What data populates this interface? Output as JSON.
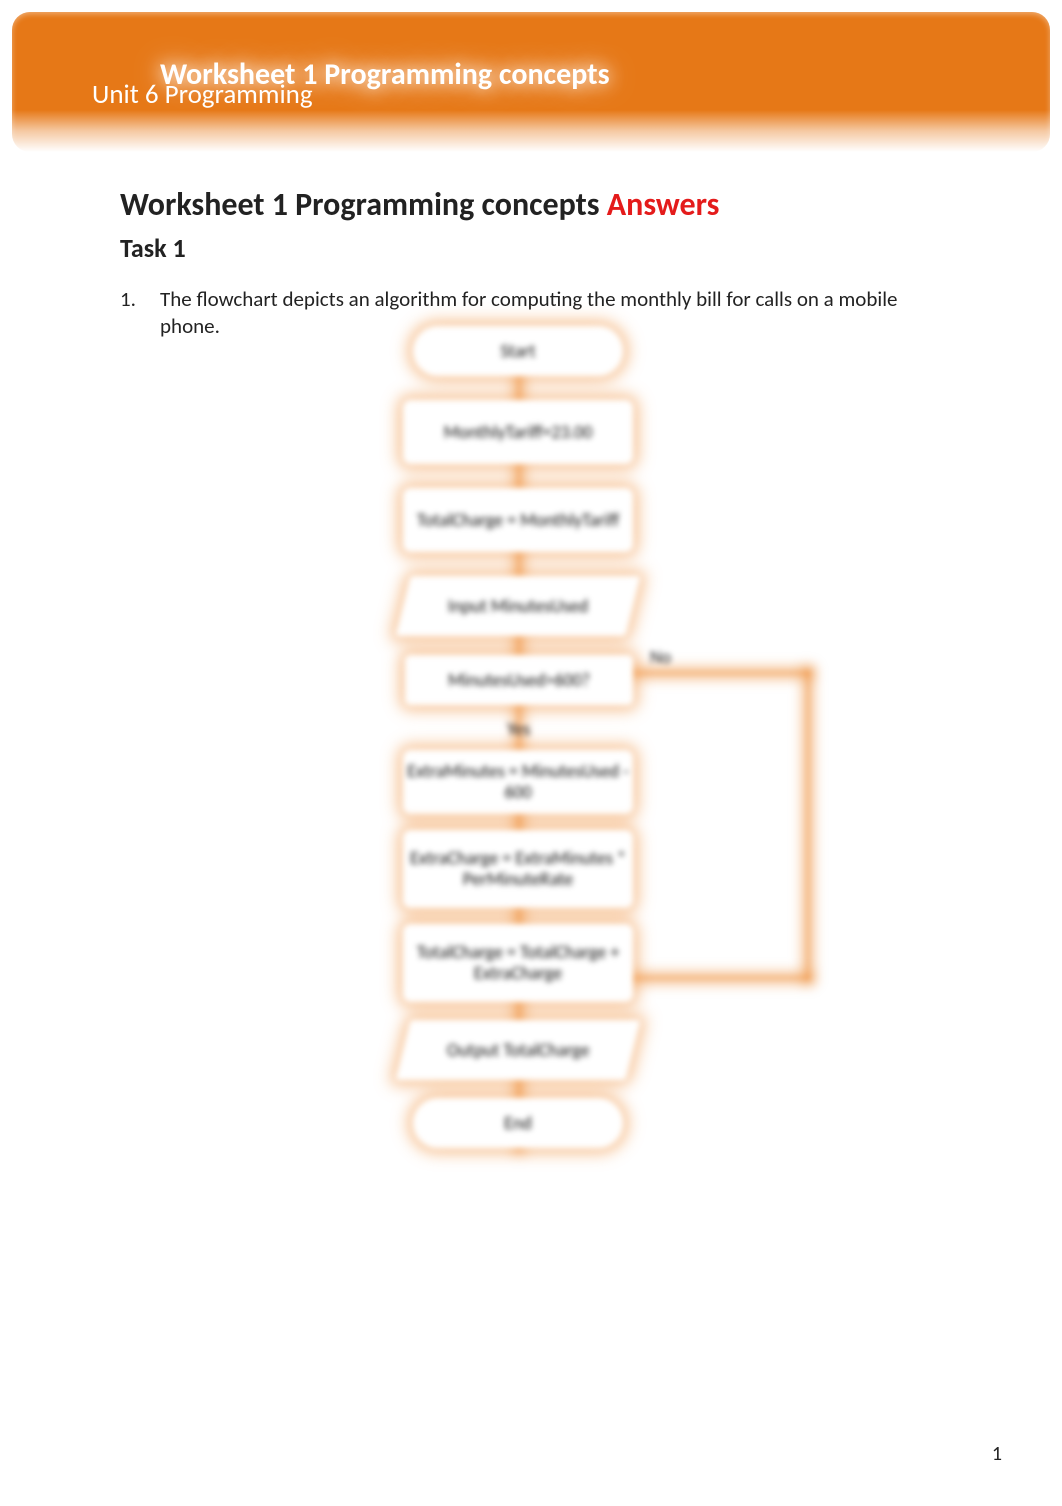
{
  "header": {
    "title": "Worksheet 1 Programming concepts",
    "subtitle": "Unit 6 Programming"
  },
  "main": {
    "heading_prefix": "Worksheet 1 Programming concepts ",
    "heading_answers": "Answers",
    "task_label": "Task 1",
    "question_number": "1.",
    "question_text": "The flowchart depicts an algorithm for computing the monthly bill for calls on a mobile phone."
  },
  "flow": {
    "start": "Start",
    "n1": "MonthlyTariff=23.00",
    "n2": "TotalCharge = MonthlyTariff",
    "n3": "Input MinutesUsed",
    "n4": "MinutesUsed>600?",
    "yes": "Yes",
    "no": "No",
    "n5": "ExtraMinutes = MinutesUsed - 600",
    "n6": "ExtraCharge = ExtraMinutes * PerMinuteRate",
    "n7": "TotalCharge = TotalCharge + ExtraCharge",
    "n8": "Output TotalCharge",
    "end": "End"
  },
  "page_number": "1"
}
